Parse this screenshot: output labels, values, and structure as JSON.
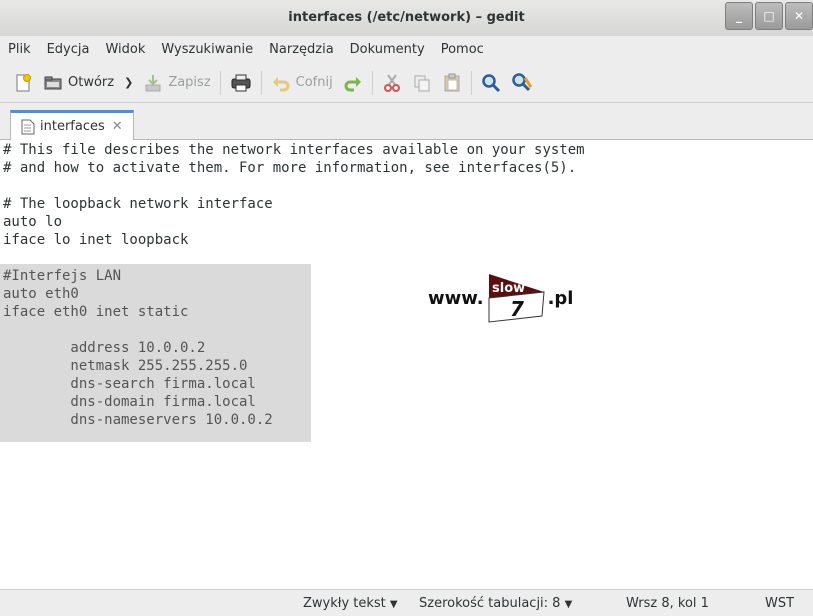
{
  "window": {
    "title": "interfaces (/etc/network) – gedit"
  },
  "menu": [
    "Plik",
    "Edycja",
    "Widok",
    "Wyszukiwanie",
    "Narzędzia",
    "Dokumenty",
    "Pomoc"
  ],
  "toolbar": {
    "open_label": "Otwórz",
    "save_label": "Zapisz",
    "undo_label": "Cofnij"
  },
  "tab": {
    "label": "interfaces"
  },
  "editor": {
    "lines": [
      "# This file describes the network interfaces available on your system",
      "# and how to activate them. For more information, see interfaces(5).",
      "",
      "# The loopback network interface",
      "auto lo",
      "iface lo inet loopback",
      "",
      "#Interfejs LAN",
      "auto eth0",
      "iface eth0 inet static",
      "",
      "        address 10.0.0.2",
      "        netmask 255.255.255.0",
      "        dns-search firma.local",
      "        dns-domain firma.local",
      "        dns-nameservers 10.0.0.2"
    ]
  },
  "watermark": {
    "prefix": "www.",
    "flag_text": "slow",
    "number": "7",
    "suffix": ".pl"
  },
  "statusbar": {
    "syntax": "Zwykły tekst",
    "tab_width": "Szerokość tabulacji:  8",
    "position": "Wrsz 8, kol 1",
    "mode": "WST"
  },
  "colors": {
    "accent": "#4a90d9",
    "selection": "#dadada",
    "watermark_flag": "#5a0e0e"
  }
}
